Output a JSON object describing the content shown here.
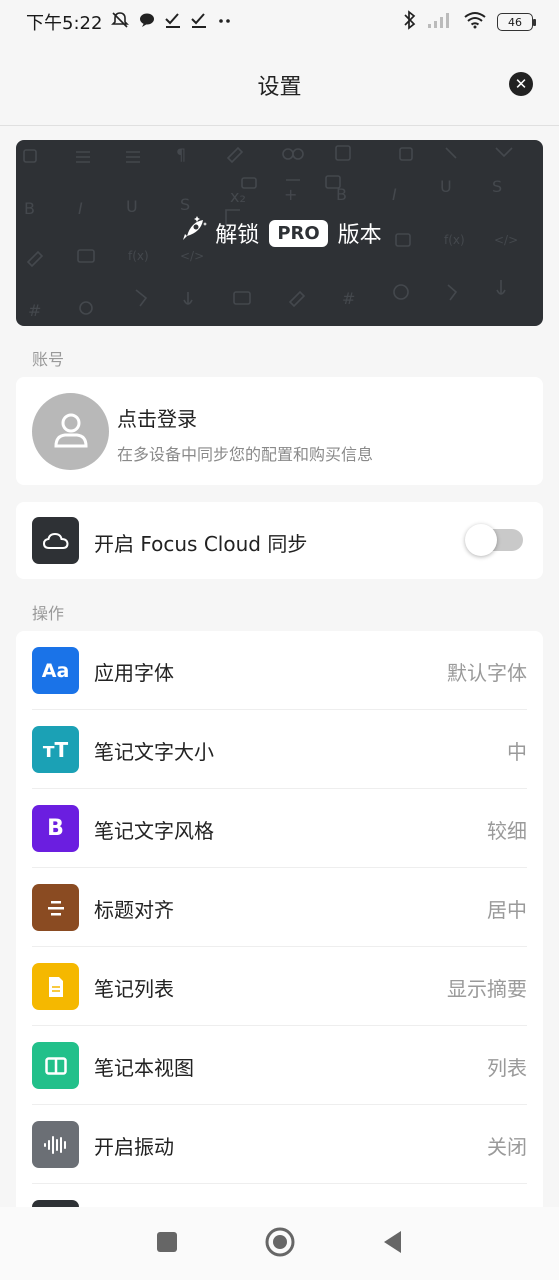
{
  "status_bar": {
    "time": "下午5:22",
    "battery": "46"
  },
  "header": {
    "title": "设置"
  },
  "pro_banner": {
    "unlock_text": "解锁",
    "badge": "PRO",
    "suffix": "版本"
  },
  "account": {
    "section_label": "账号",
    "title": "点击登录",
    "subtitle": "在多设备中同步您的配置和购买信息"
  },
  "cloud": {
    "label": "开启 Focus Cloud 同步",
    "enabled": false
  },
  "operations": {
    "section_label": "操作",
    "items": [
      {
        "label": "应用字体",
        "value": "默认字体",
        "icon": "font-icon",
        "glyph": "Aa",
        "color": "#1a73e8"
      },
      {
        "label": "笔记文字大小",
        "value": "中",
        "icon": "text-size-icon",
        "glyph": "тT",
        "color": "#1ba1b5"
      },
      {
        "label": "笔记文字风格",
        "value": "较细",
        "icon": "bold-icon",
        "glyph": "B",
        "color": "#6b1ee0"
      },
      {
        "label": "标题对齐",
        "value": "居中",
        "icon": "align-center-icon",
        "glyph": "",
        "color": "#8a4b22"
      },
      {
        "label": "笔记列表",
        "value": "显示摘要",
        "icon": "document-icon",
        "glyph": "",
        "color": "#f5b800"
      },
      {
        "label": "笔记本视图",
        "value": "列表",
        "icon": "columns-icon",
        "glyph": "",
        "color": "#22c08a"
      },
      {
        "label": "开启振动",
        "value": "关闭",
        "icon": "waveform-icon",
        "glyph": "",
        "color": "#6b6f75"
      }
    ]
  },
  "colors": {
    "banner_bg": "#2e3135",
    "toggle_off": "#c9c9c9"
  }
}
